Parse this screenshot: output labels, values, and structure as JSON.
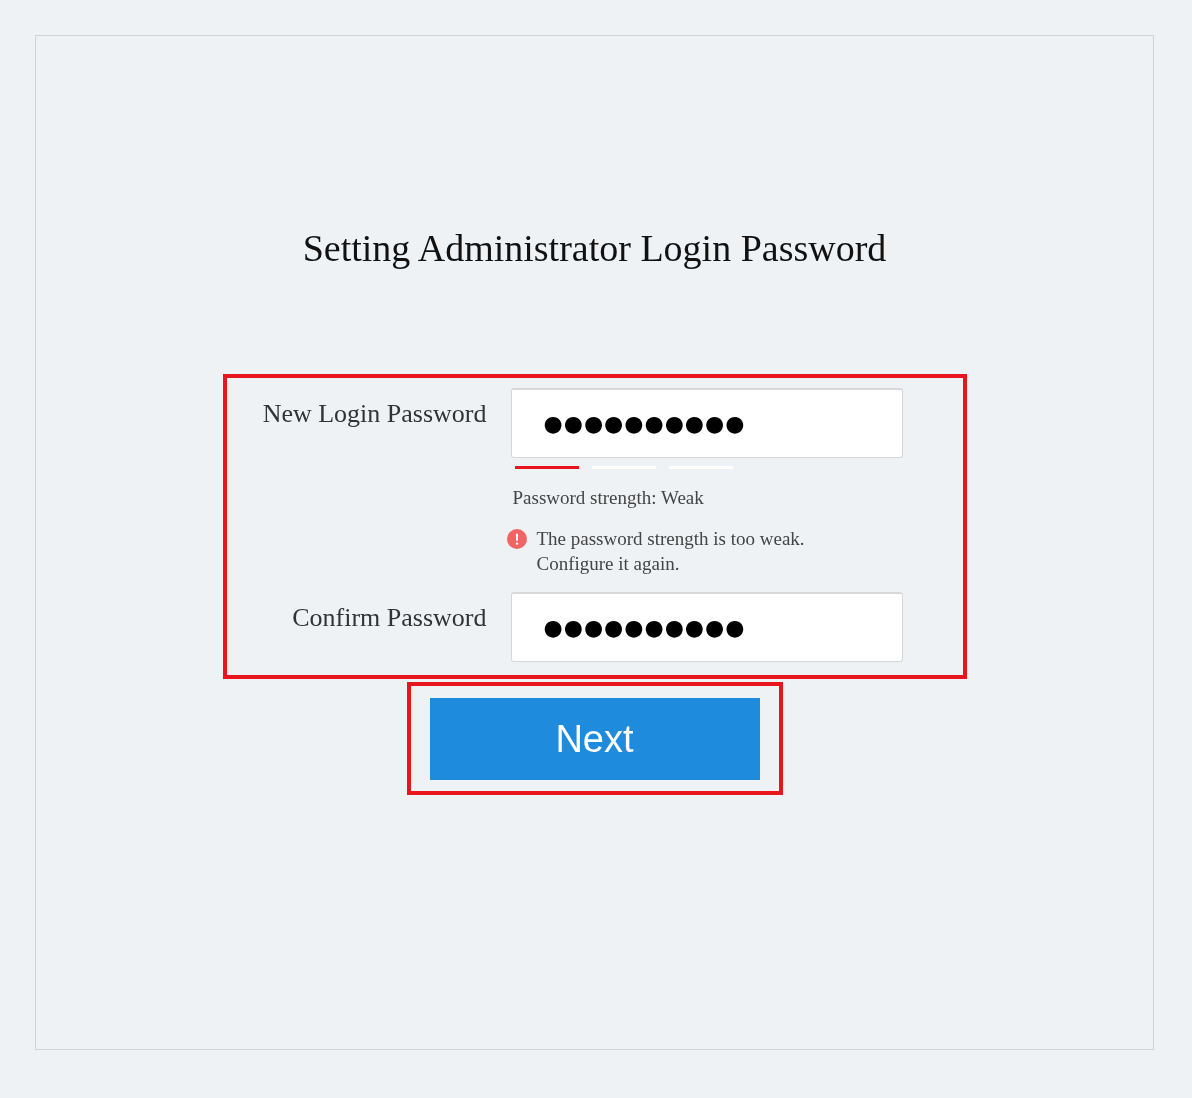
{
  "title": "Setting Administrator Login Password",
  "fields": [
    {
      "label": "New Login Password",
      "value": "●●●●●●●●●●"
    },
    {
      "label": "Confirm Password",
      "value": "●●●●●●●●●●"
    }
  ],
  "strength": {
    "segments": [
      {
        "on": true
      },
      {
        "on": false
      },
      {
        "on": false
      }
    ],
    "text": "Password strength: Weak"
  },
  "error": "The password strength is too weak.\nConfigure it again.",
  "next_button": "Next"
}
